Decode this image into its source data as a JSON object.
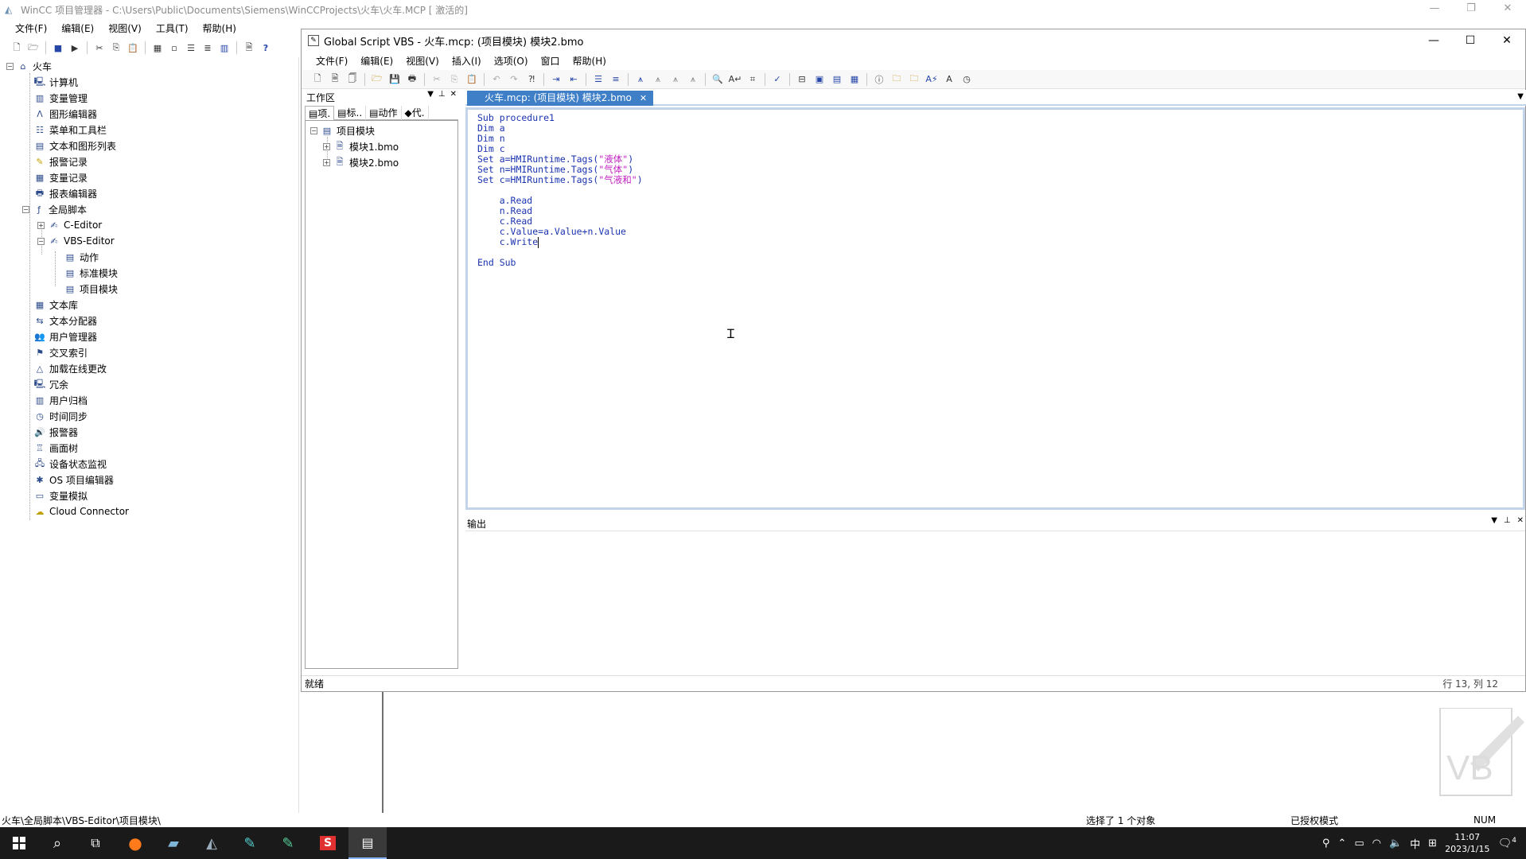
{
  "wincc": {
    "title": "WinCC 项目管理器 - C:\\Users\\Public\\Documents\\Siemens\\WinCCProjects\\火车\\火车.MCP [ 激活的]",
    "menu": [
      "文件(F)",
      "编辑(E)",
      "视图(V)",
      "工具(T)",
      "帮助(H)"
    ],
    "tree": {
      "root": "火车",
      "items": [
        "计算机",
        "变量管理",
        "图形编辑器",
        "菜单和工具栏",
        "文本和图形列表",
        "报警记录",
        "变量记录",
        "报表编辑器",
        "全局脚本"
      ],
      "global_script_children": [
        "C-Editor",
        "VBS-Editor"
      ],
      "vbs_children": [
        "动作",
        "标准模块",
        "项目模块"
      ],
      "items_after": [
        "文本库",
        "文本分配器",
        "用户管理器",
        "交叉索引",
        "加载在线更改",
        "冗余",
        "用户归档",
        "时间同步",
        "报警器",
        "画面树",
        "设备状态监视",
        "OS 项目编辑器",
        "变量模拟",
        "Cloud Connector"
      ]
    },
    "status": {
      "path": "火车\\全局脚本\\VBS-Editor\\项目模块\\",
      "selection": "选择了 1 个对象",
      "license": "已授权模式",
      "num": "NUM"
    }
  },
  "gs": {
    "title": "Global Script VBS - 火车.mcp: (项目模块) 模块2.bmo",
    "menu": [
      "文件(F)",
      "编辑(E)",
      "视图(V)",
      "插入(I)",
      "选项(O)",
      "窗口",
      "帮助(H)"
    ],
    "workspace": {
      "title": "工作区",
      "tabs": [
        "项.",
        "标..",
        "动作",
        "代."
      ],
      "root": "项目模块",
      "children": [
        "模块1.bmo",
        "模块2.bmo"
      ]
    },
    "editor": {
      "tab": "火车.mcp: (项目模块) 模块2.bmo",
      "lines": [
        {
          "t": "Sub procedure1"
        },
        {
          "t": "Dim a"
        },
        {
          "t": "Dim n"
        },
        {
          "t": "Dim c"
        },
        {
          "t": "Set a=HMIRuntime.Tags(",
          "s": "\"液体\"",
          "e": ")"
        },
        {
          "t": "Set n=HMIRuntime.Tags(",
          "s": "\"气体\"",
          "e": ")"
        },
        {
          "t": "Set c=HMIRuntime.Tags(",
          "s": "\"气液和\"",
          "e": ")"
        },
        {
          "t": ""
        },
        {
          "t": "    a.Read"
        },
        {
          "t": "    n.Read"
        },
        {
          "t": "    c.Read"
        },
        {
          "t": "    c.Value=a.Value+n.Value"
        },
        {
          "t": "    c.Write",
          "cursor": true
        },
        {
          "t": ""
        },
        {
          "t": "End Sub"
        }
      ]
    },
    "output_title": "输出",
    "status": "就绪",
    "position": "行 13, 列 12"
  },
  "taskbar": {
    "time": "11:07",
    "date": "2023/1/15",
    "ime": "中",
    "notification_count": "4"
  },
  "watermark": "VB"
}
